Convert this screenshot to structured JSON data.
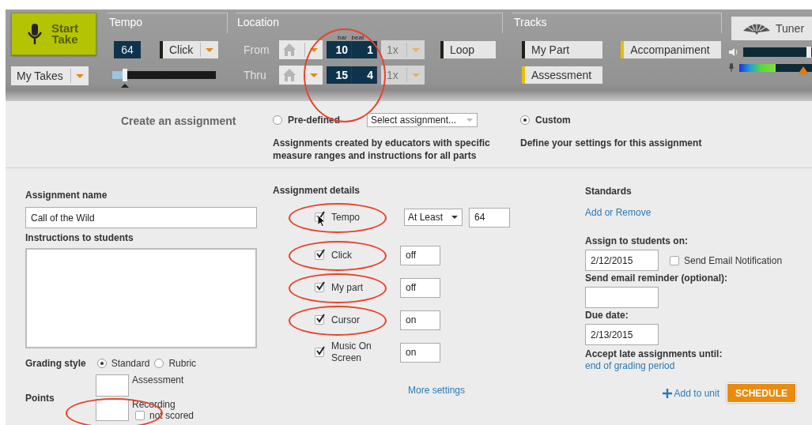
{
  "toolbar": {
    "start_button": {
      "label": "Start Take"
    },
    "takes_dropdown": {
      "label": "My Takes"
    },
    "tempo": {
      "title": "Tempo",
      "value": "64",
      "click": {
        "label": "Click",
        "on": false
      },
      "slider": {
        "level": 0.12
      }
    },
    "location": {
      "title": "Location",
      "bar_label": "bar",
      "beat_label": "beat",
      "circled": true,
      "loop": {
        "label": "Loop",
        "on": false
      },
      "rows": [
        {
          "label": "From",
          "bar": "10",
          "beat": "1",
          "speed": "1x",
          "disabled": true
        },
        {
          "label": "Thru",
          "bar": "15",
          "beat": "4",
          "speed": "1x",
          "disabled": true
        }
      ]
    },
    "tracks": {
      "title": "Tracks",
      "items": [
        {
          "label": "My Part",
          "on": false
        },
        {
          "label": "Accompaniment",
          "on": true
        },
        {
          "label": "Assessment",
          "on": true
        }
      ]
    },
    "tuner": {
      "label": "Tuner"
    },
    "output_volume": {
      "level": 0.95
    },
    "input_meter": {
      "level": 0.5
    }
  },
  "create": {
    "title": "Create an assignment",
    "options": [
      {
        "label": "Pre-defined",
        "selected": false,
        "select": "Select assignment...",
        "description": "Assignments created by educators with specific measure ranges and instructions for all parts"
      },
      {
        "label": "Custom",
        "selected": true,
        "description": "Define your settings for this assignment"
      }
    ]
  },
  "form": {
    "name": {
      "label": "Assignment name",
      "value": "Call of the Wild"
    },
    "instructions": {
      "label": "Instructions to students"
    },
    "grading": {
      "label": "Grading style",
      "options": [
        {
          "label": "Standard",
          "selected": true
        },
        {
          "label": "Rubric",
          "selected": false
        }
      ]
    },
    "points": {
      "label": "Points",
      "items": [
        {
          "label": "Assessment"
        },
        {
          "label": "Recording",
          "circled": true,
          "not_scored": {
            "label": "not scored",
            "checked": false
          }
        }
      ]
    }
  },
  "details": {
    "title": "Assignment details",
    "items": [
      {
        "kind": "tempo",
        "label": "Tempo",
        "checked": true,
        "circled": true,
        "mode": "At Least",
        "value": "64"
      },
      {
        "kind": "text",
        "label": "Click",
        "checked": true,
        "circled": true,
        "value": "off"
      },
      {
        "kind": "text",
        "label": "My part",
        "checked": true,
        "circled": true,
        "value": "off"
      },
      {
        "kind": "text",
        "label": "Cursor",
        "checked": true,
        "circled": true,
        "value": "on"
      },
      {
        "kind": "text",
        "label": "Music On Screen",
        "checked": true,
        "value": "on"
      }
    ],
    "more_link": "More settings"
  },
  "standards": {
    "title": "Standards",
    "link": "Add or Remove"
  },
  "schedule": {
    "assign_label": "Assign to students on:",
    "assign_date": "2/12/2015",
    "email": {
      "label": "Send Email Notification",
      "checked": false
    },
    "reminder_label": "Send email reminder (optional):",
    "due_label": "Due date:",
    "due_date": "2/13/2015",
    "late_label": "Accept late assignments until:",
    "late_link": "end of grading period",
    "add_unit": "Add to unit",
    "button": "SCHEDULE"
  }
}
